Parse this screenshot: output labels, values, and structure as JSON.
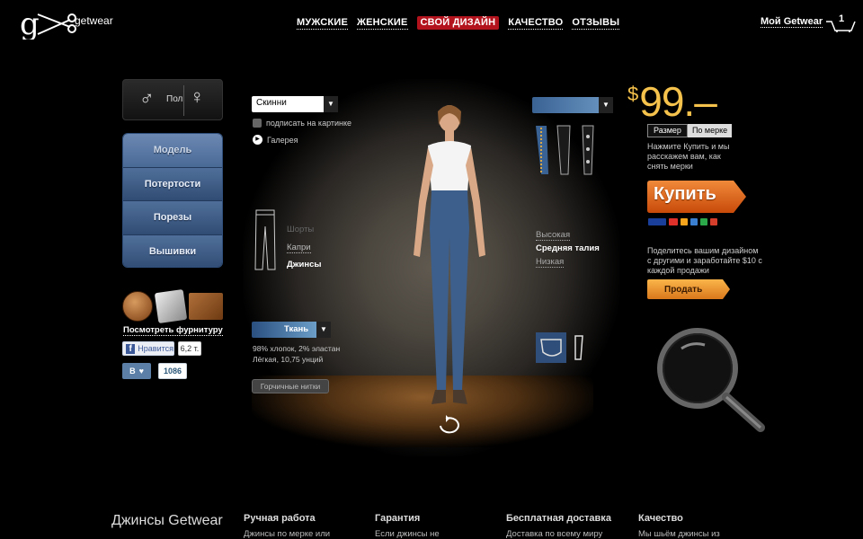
{
  "header": {
    "logo_text": "getwear",
    "nav": [
      "МУЖСКИЕ",
      "ЖЕНСКИЕ",
      "СВОЙ ДИЗАЙН",
      "КАЧЕСТВО",
      "ОТЗЫВЫ"
    ],
    "active_nav": "СВОЙ ДИЗАЙН",
    "my_account": "Мой Getwear",
    "cart_count": "1"
  },
  "left": {
    "gender_label": "Пол",
    "male_symbol": "♂",
    "female_symbol": "♀",
    "menu": [
      "Модель",
      "Потертости",
      "Порезы",
      "Вышивки"
    ],
    "hardware_link": "Посмотреть фурнитуру",
    "fb_like": "Нравится",
    "fb_count": "6,2 т.",
    "vk_label": "В",
    "vk_count": "1086"
  },
  "stage": {
    "fit_value": "Скинни",
    "sign_label": "подписать на картинке",
    "gallery_label": "Галерея",
    "lengths": [
      "Шорты",
      "Капри",
      "Джинсы"
    ],
    "selected_length": "Джинсы",
    "fabric_value": "Ткань",
    "fabric_desc_1": "98% хлопок, 2% эластан",
    "fabric_desc_2": "Лёгкая, 10,75 унций",
    "thread_button": "Горчичные нитки",
    "rises": [
      "Высокая",
      "Средняя талия",
      "Низкая"
    ],
    "selected_rise": "Средняя талия"
  },
  "right": {
    "currency": "$",
    "price": "99.–",
    "size_tab_1": "Размер",
    "size_tab_2": "По мерке",
    "size_note": "Нажмите Купить и мы расскажем вам, как снять мерки",
    "buy_label": "Купить",
    "share_note": "Поделитесь вашим дизайном с другими и заработайте $10 с каждой продажи",
    "sell_label": "Продать"
  },
  "footer": {
    "title": "Джинсы Getwear",
    "columns": [
      {
        "heading": "Ручная работа",
        "text": "Джинсы по мерке или"
      },
      {
        "heading": "Гарантия",
        "text": "Если джинсы не"
      },
      {
        "heading": "Бесплатная доставка",
        "text": "Доставка по всему миру"
      },
      {
        "heading": "Качество",
        "text": "Мы шьём джинсы из"
      }
    ]
  },
  "colors": {
    "accent_red": "#b3131d",
    "price_gold": "#f5c24c",
    "buy_orange": "#e8671e",
    "menu_blue": "#4a6a96"
  }
}
